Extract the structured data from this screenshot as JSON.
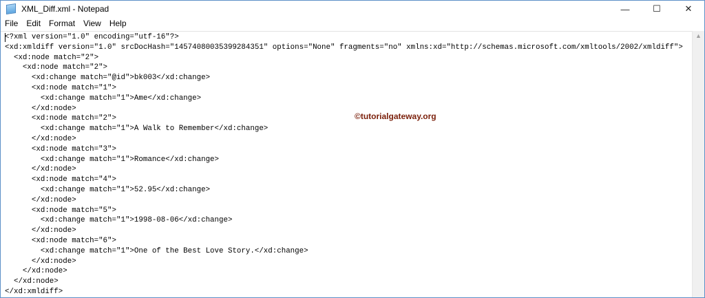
{
  "window": {
    "title": "XML_Diff.xml - Notepad",
    "minimize": "—",
    "maximize": "☐",
    "close": "✕"
  },
  "menu": [
    "File",
    "Edit",
    "Format",
    "View",
    "Help"
  ],
  "lines": [
    "<?xml version=\"1.0\" encoding=\"utf-16\"?>",
    "<xd:xmldiff version=\"1.0\" srcDocHash=\"14574080035399284351\" options=\"None\" fragments=\"no\" xmlns:xd=\"http://schemas.microsoft.com/xmltools/2002/xmldiff\">",
    "  <xd:node match=\"2\">",
    "    <xd:node match=\"2\">",
    "      <xd:change match=\"@id\">bk003</xd:change>",
    "      <xd:node match=\"1\">",
    "        <xd:change match=\"1\">Ame</xd:change>",
    "      </xd:node>",
    "      <xd:node match=\"2\">",
    "        <xd:change match=\"1\">A Walk to Remember</xd:change>",
    "      </xd:node>",
    "      <xd:node match=\"3\">",
    "        <xd:change match=\"1\">Romance</xd:change>",
    "      </xd:node>",
    "      <xd:node match=\"4\">",
    "        <xd:change match=\"1\">52.95</xd:change>",
    "      </xd:node>",
    "      <xd:node match=\"5\">",
    "        <xd:change match=\"1\">1998-08-06</xd:change>",
    "      </xd:node>",
    "      <xd:node match=\"6\">",
    "        <xd:change match=\"1\">One of the Best Love Story.</xd:change>",
    "      </xd:node>",
    "    </xd:node>",
    "  </xd:node>",
    "</xd:xmldiff>"
  ],
  "watermark": "©tutorialgateway.org"
}
